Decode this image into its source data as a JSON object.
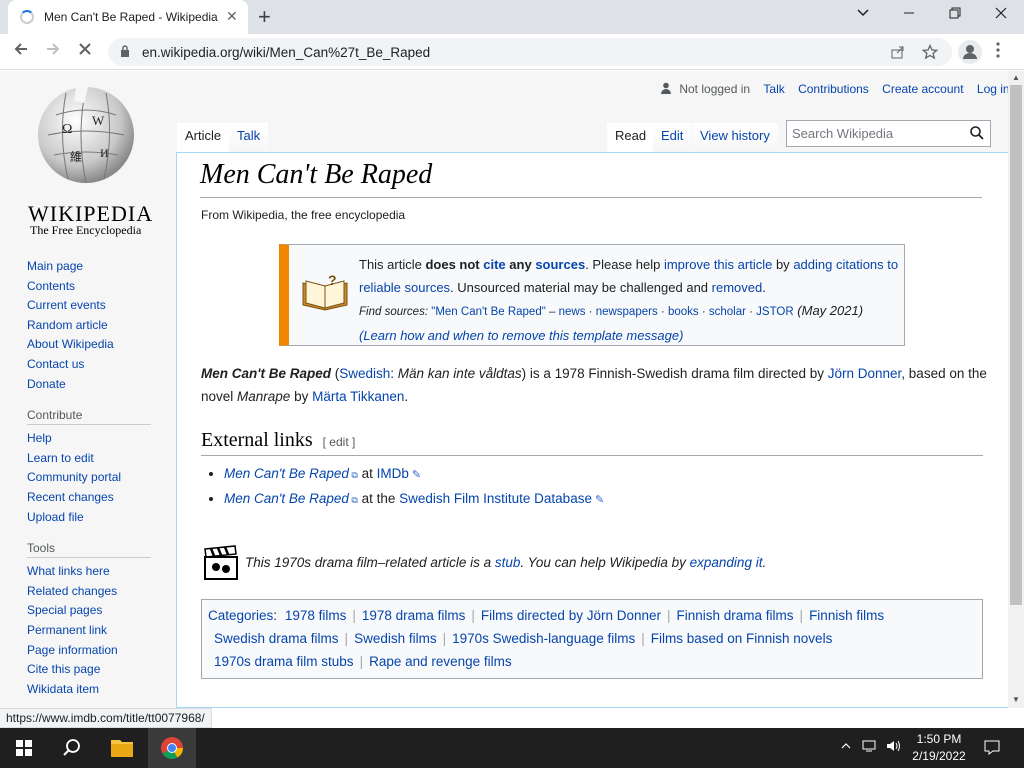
{
  "browser": {
    "tab_title": "Men Can't Be Raped - Wikipedia",
    "tab_close": "✕",
    "new_tab": "+",
    "url": "en.wikipedia.org/wiki/Men_Can%27t_Be_Raped",
    "status_url": "https://www.imdb.com/title/tt0077968/"
  },
  "wiki": {
    "logo_word": "WIKIPEDIA",
    "logo_tagline": "The Free Encyclopedia",
    "personal": {
      "not_logged_in": "Not logged in",
      "talk": "Talk",
      "contributions": "Contributions",
      "create_account": "Create account",
      "log_in": "Log in"
    },
    "tabs": {
      "article": "Article",
      "talk": "Talk",
      "read": "Read",
      "edit": "Edit",
      "view_history": "View history"
    },
    "search_placeholder": "Search Wikipedia",
    "sidebar": {
      "nav": [
        "Main page",
        "Contents",
        "Current events",
        "Random article",
        "About Wikipedia",
        "Contact us",
        "Donate"
      ],
      "contribute_heading": "Contribute",
      "contribute": [
        "Help",
        "Learn to edit",
        "Community portal",
        "Recent changes",
        "Upload file"
      ],
      "tools_heading": "Tools",
      "tools": [
        "What links here",
        "Related changes",
        "Special pages",
        "Permanent link",
        "Page information",
        "Cite this page",
        "Wikidata item"
      ]
    },
    "title": "Men Can't Be Raped",
    "from": "From Wikipedia, the free encyclopedia",
    "notice": {
      "t1": "This article ",
      "t2": "does not ",
      "cite": "cite",
      "t3": " ",
      "any": "any",
      "t4": " ",
      "sources": "sources",
      "t5": ". Please help ",
      "improve": "improve this article",
      "t6": " by ",
      "adding": "adding citations to reliable sources",
      "t7": ". Unsourced material may be challenged and ",
      "removed": "removed",
      "t8": ".",
      "find_sources": "Find sources: ",
      "q": "\"Men Can't Be Raped\"",
      "dash": " – ",
      "news": "news",
      "dot1": " · ",
      "newspapers": "newspapers",
      "dot2": " · ",
      "books": "books",
      "dot3": " · ",
      "scholar": "scholar",
      "dot4": " · ",
      "jstor": "JSTOR",
      "date": " (May 2021)",
      "learn": "(Learn how and when to remove this template message)"
    },
    "lead": {
      "bold": "Men Can't Be Raped",
      "p1": " (",
      "swedish": "Swedish",
      "p2": ": ",
      "alt": "Män kan inte våldtas",
      "p3": ") is a 1978 Finnish-Swedish drama film directed by ",
      "director": "Jörn Donner",
      "p4": ", based on the novel ",
      "novel": "Manrape",
      "p5": " by ",
      "author": "Märta Tikkanen",
      "p6": "."
    },
    "ext_heading": "External links",
    "ext_edit": "[ edit ]",
    "ext_links": [
      {
        "title": "Men Can't Be Raped",
        "mid": " at ",
        "site": "IMDb"
      },
      {
        "title": "Men Can't Be Raped",
        "mid": " at the ",
        "site": "Swedish Film Institute Database"
      }
    ],
    "stub": {
      "t1": "This 1970s drama film–related article is a ",
      "stub": "stub",
      "t2": ". You can help Wikipedia by ",
      "expanding": "expanding it",
      "t3": "."
    },
    "categories_label": "Categories",
    "categories": [
      "1978 films",
      "1978 drama films",
      "Films directed by Jörn Donner",
      "Finnish drama films",
      "Finnish films",
      "Swedish drama films",
      "Swedish films",
      "1970s Swedish-language films",
      "Films based on Finnish novels",
      "1970s drama film stubs",
      "Rape and revenge films"
    ]
  },
  "taskbar": {
    "time": "1:50 PM",
    "date": "2/19/2022"
  },
  "colors": {
    "link": "#0645ad",
    "notice_border": "#f28500",
    "taskbar": "#1f1f1f"
  }
}
